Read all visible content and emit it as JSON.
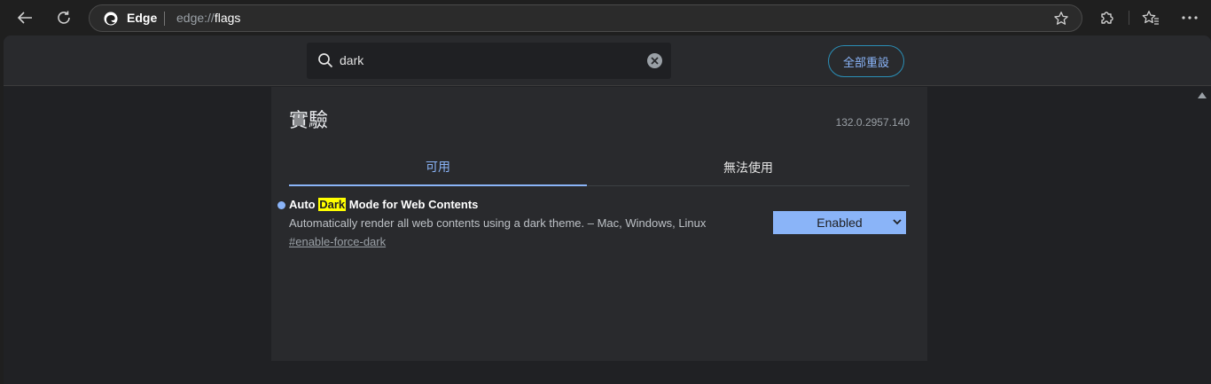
{
  "browser": {
    "brand": "Edge",
    "url_scheme": "edge://",
    "url_host": "flags",
    "back_icon": "back-arrow-icon",
    "reload_icon": "reload-icon",
    "favorite_icon": "star-icon",
    "extensions_icon": "puzzle-icon",
    "favorites_icon": "favorites-icon",
    "menu_icon": "ellipsis-icon"
  },
  "header": {
    "search_value": "dark",
    "reset_label": "全部重設"
  },
  "main": {
    "title": "實驗",
    "version": "132.0.2957.140",
    "tabs": [
      {
        "label": "可用",
        "active": true
      },
      {
        "label": "無法使用",
        "active": false
      }
    ]
  },
  "flag": {
    "name_before": "Auto ",
    "name_highlight": "Dark",
    "name_after": " Mode for Web Contents",
    "description": "Automatically render all web contents using a dark theme. – Mac, Windows, Linux",
    "link": "#enable-force-dark",
    "selected_value": "Enabled"
  },
  "colors": {
    "accent": "#8ab4f8",
    "highlight": "#ffff00",
    "reset_border": "#2a8fb7"
  }
}
